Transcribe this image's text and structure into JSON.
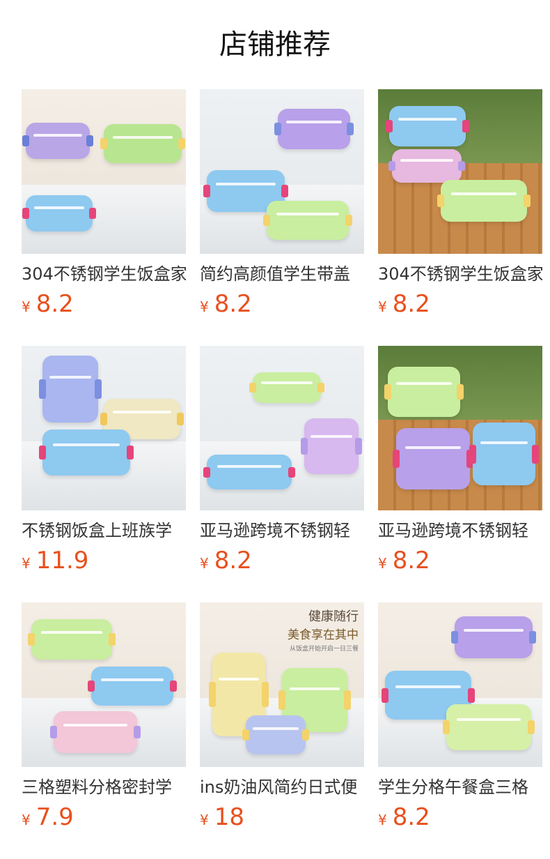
{
  "header": {
    "title": "店铺推荐"
  },
  "currency_symbol": "¥",
  "products": [
    {
      "name": "304不锈钢学生饭盒家",
      "price": "8.2",
      "scene": "warm",
      "boxes": [
        {
          "c": "#b9a6e6",
          "k": "#6a7fd8"
        },
        {
          "c": "#b8e58f",
          "k": "#f3d36a"
        },
        {
          "c": "#8ec9f0",
          "k": "#e5457a"
        }
      ]
    },
    {
      "name": "简约高颜值学生带盖",
      "price": "8.2",
      "scene": "light",
      "boxes": [
        {
          "c": "#b8a0ea",
          "k": "#7c8fe0"
        },
        {
          "c": "#8ec9f0",
          "k": "#e5457a"
        },
        {
          "c": "#c9ee9f",
          "k": "#f3d36a"
        }
      ]
    },
    {
      "name": "304不锈钢学生饭盒家",
      "price": "8.2",
      "scene": "wood",
      "boxes": [
        {
          "c": "#8ec9f0",
          "k": "#e5457a"
        },
        {
          "c": "#e7b8e0",
          "k": "#b59ce8"
        },
        {
          "c": "#c9ee9f",
          "k": "#f3d36a"
        }
      ]
    },
    {
      "name": "不锈钢饭盒上班族学",
      "price": "11.9",
      "scene": "light",
      "boxes": [
        {
          "c": "#a9b6f0",
          "k": "#7c8fe0"
        },
        {
          "c": "#f0e7c3",
          "k": "#f0c85a"
        },
        {
          "c": "#8ec9f0",
          "k": "#e5457a"
        }
      ]
    },
    {
      "name": "亚马逊跨境不锈钢轻",
      "price": "8.2",
      "scene": "light",
      "boxes": [
        {
          "c": "#c9ee9f",
          "k": "#f3d36a"
        },
        {
          "c": "#d7b8ef",
          "k": "#b59ce8"
        },
        {
          "c": "#8ec9f0",
          "k": "#e5457a"
        }
      ]
    },
    {
      "name": "亚马逊跨境不锈钢轻",
      "price": "8.2",
      "scene": "wood",
      "boxes": [
        {
          "c": "#c9ee9f",
          "k": "#f3d36a"
        },
        {
          "c": "#b8a0ea",
          "k": "#e5457a"
        },
        {
          "c": "#8ec9f0",
          "k": "#e5457a"
        }
      ]
    },
    {
      "name": "三格塑料分格密封学",
      "price": "7.9",
      "scene": "warm",
      "boxes": [
        {
          "c": "#c9ee9f",
          "k": "#f3d36a"
        },
        {
          "c": "#8ec9f0",
          "k": "#e5457a"
        },
        {
          "c": "#f3c6d8",
          "k": "#b59ce8"
        }
      ]
    },
    {
      "name": "ins奶油风简约日式便",
      "price": "18",
      "scene": "warm",
      "promo": {
        "line1": "健康随行",
        "line2": "美食享在其中",
        "line3": "从饭盒开始开启一日三餐"
      },
      "boxes": [
        {
          "c": "#f3e7a8",
          "k": "#f3d36a"
        },
        {
          "c": "#c9ee9f",
          "k": "#f3d36a"
        },
        {
          "c": "#b8c4f0",
          "k": "#f3d36a"
        }
      ]
    },
    {
      "name": "学生分格午餐盒三格",
      "price": "8.2",
      "scene": "warm",
      "boxes": [
        {
          "c": "#b8a0ea",
          "k": "#7c8fe0"
        },
        {
          "c": "#8ec9f0",
          "k": "#e5457a"
        },
        {
          "c": "#d6f0a8",
          "k": "#f3d36a"
        }
      ]
    }
  ]
}
